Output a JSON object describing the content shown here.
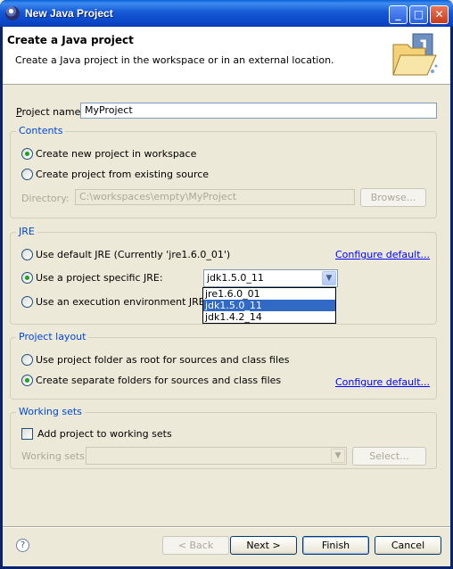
{
  "window": {
    "title": "New Java Project",
    "controls": {
      "minimize": "minimize-icon",
      "maximize": "maximize-icon",
      "close": "close-icon"
    }
  },
  "banner": {
    "title": "Create a Java project",
    "description": "Create a Java project in the workspace or in an external location."
  },
  "project_name": {
    "label": "Project name:",
    "value": "MyProject"
  },
  "contents": {
    "title": "Contents",
    "option_new": "Create new project in workspace",
    "option_existing": "Create project from existing source",
    "directory_label": "Directory:",
    "directory_value": "C:\\workspaces\\empty\\MyProject",
    "browse_label": "Browse..."
  },
  "jre": {
    "title": "JRE",
    "option_default": "Use default JRE (Currently 'jre1.6.0_01')",
    "configure_label": "Configure default...",
    "option_specific": "Use a project specific JRE:",
    "option_env": "Use an execution environment JRE:",
    "selected": "jdk1.5.0_11",
    "options": [
      "jre1.6.0_01",
      "jdk1.5.0_11",
      "jdk1.4.2_14"
    ]
  },
  "layout": {
    "title": "Project layout",
    "option_root": "Use project folder as root for sources and class files",
    "option_separate": "Create separate folders for sources and class files",
    "configure_label": "Configure default..."
  },
  "working_sets": {
    "title": "Working sets",
    "add_label": "Add project to working sets",
    "sets_label": "Working sets:",
    "select_label": "Select..."
  },
  "footer": {
    "back": "< Back",
    "next": "Next >",
    "finish": "Finish",
    "cancel": "Cancel"
  },
  "colors": {
    "accent": "#316ac5",
    "group_title": "#0046d5",
    "link": "#0000ff"
  }
}
